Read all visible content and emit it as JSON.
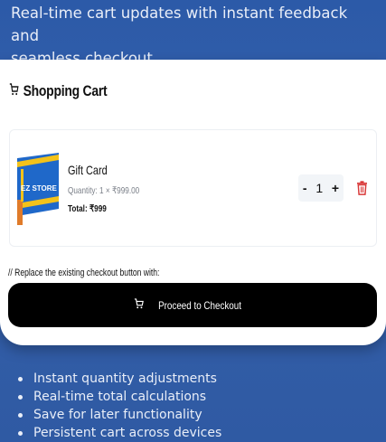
{
  "intro": {
    "line1": "Real-time cart updates with instant feedback and",
    "line2": "seamless checkout."
  },
  "cart": {
    "title": "Shopping Cart",
    "title_icon": "cart-icon",
    "item": {
      "name": "Gift Card",
      "quantity_text": "Quantity: 1 × ₹999.00",
      "total_text": "Total: ₹999",
      "quantity": "1",
      "decrement": "-",
      "increment": "+",
      "delete_icon": "trash-icon",
      "thumbnail_text": "EZ STORE"
    },
    "comment": "// Replace the existing checkout button with:",
    "checkout_label": "Proceed to Checkout"
  },
  "features": [
    "Instant quantity adjustments",
    "Real-time total calculations",
    "Save for later functionality",
    "Persistent cart across devices"
  ],
  "colors": {
    "background": "#2f5aa6",
    "delete": "#d93a3a",
    "checkout_bg": "#000000"
  }
}
